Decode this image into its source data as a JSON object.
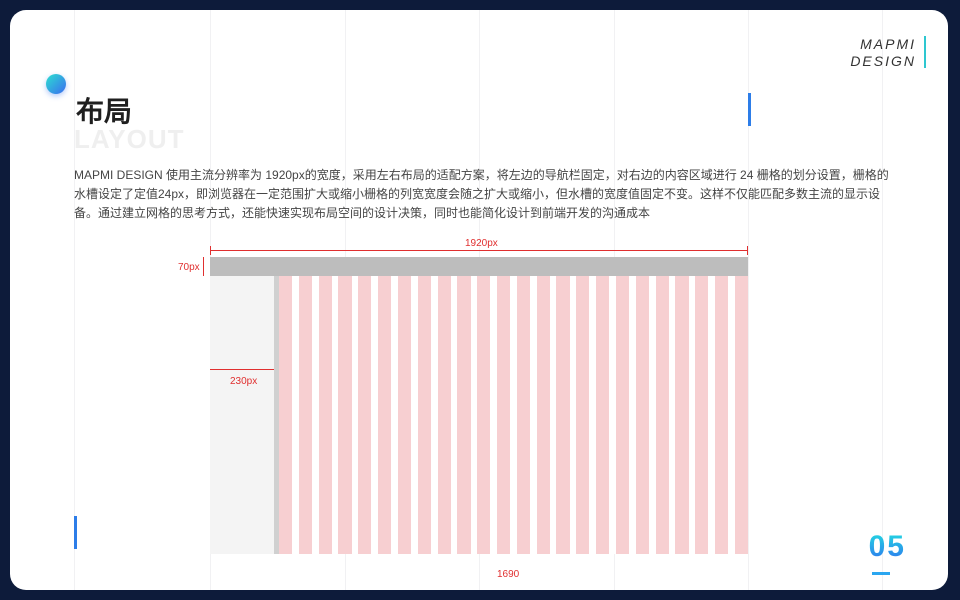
{
  "brand": {
    "line1": "MAPMI",
    "line2": "DESIGN"
  },
  "heading": {
    "title": "布局",
    "subtitle": "LAYOUT"
  },
  "description": "MAPMI DESIGN 使用主流分辨率为 1920px的宽度，采用左右布局的适配方案，将左边的导航栏固定，对右边的内容区域进行 24 栅格的划分设置，栅格的水槽设定了定值24px，即浏览器在一定范围扩大或缩小栅格的列宽宽度会随之扩大或缩小，但水槽的宽度值固定不变。这样不仅能匹配多数主流的显示设备。通过建立网格的思考方式，还能快速实现布局空间的设计决策，同时也能简化设计到前端开发的沟通成本",
  "diagram": {
    "width_label": "1920px",
    "header_height_label": "70px",
    "sidebar_width_label": "230px",
    "content_width_label": "1690",
    "column_count": 24,
    "colors": {
      "header": "#bdbdbd",
      "sidebar": "#f4f4f4",
      "column": "#f7cfd1",
      "dimension": "#e02f2f"
    }
  },
  "page": {
    "number": "05"
  }
}
